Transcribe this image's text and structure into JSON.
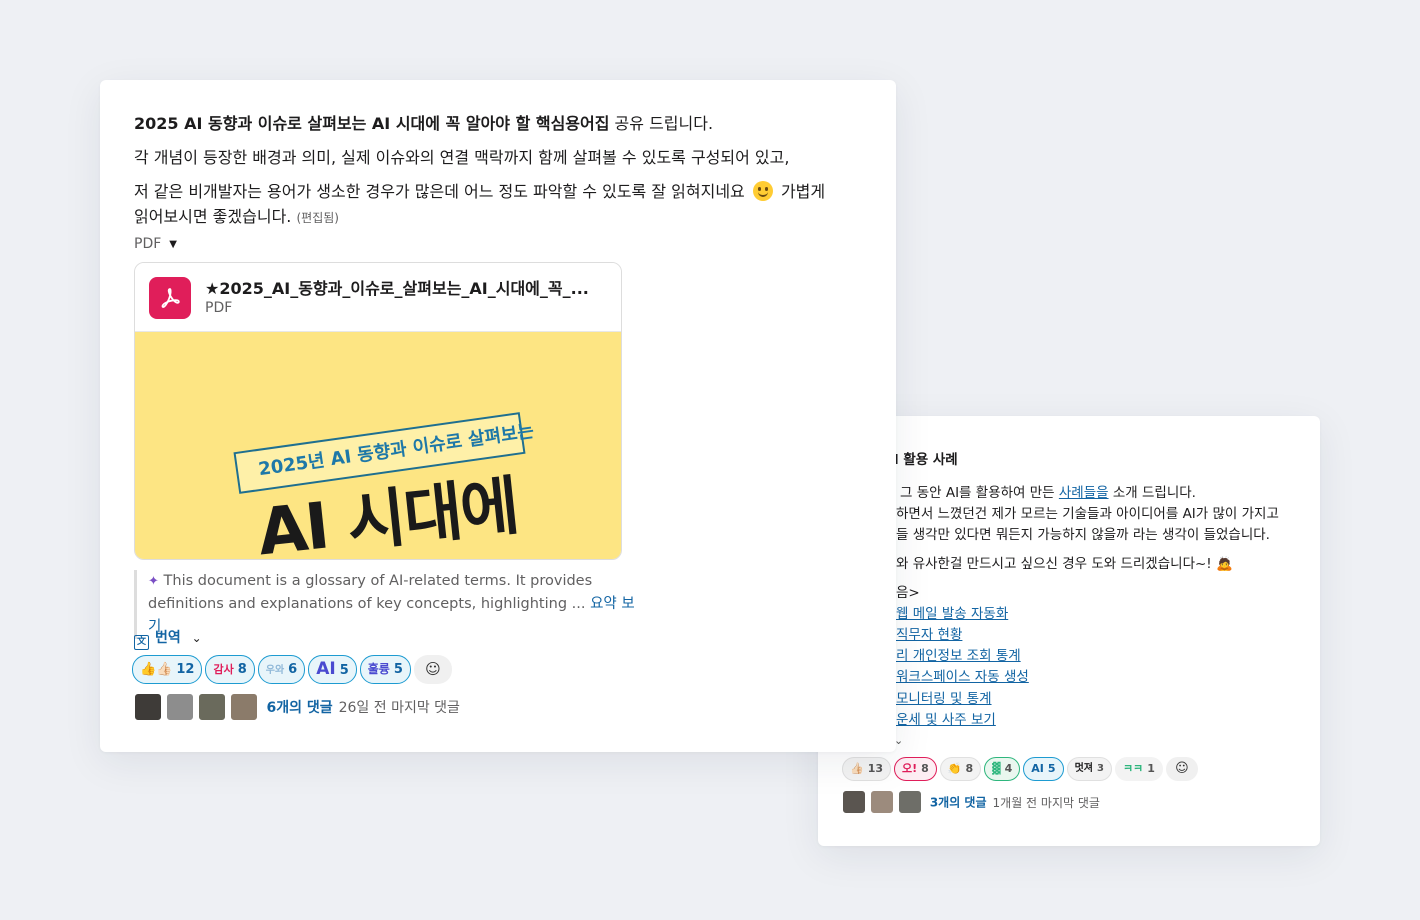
{
  "back_card": {
    "title": "l 활용 사례",
    "line1_pre": "그 동안 AI를 활용하여 만든 ",
    "line1_link": "사례들을",
    "line1_post": " 소개 드립니다.",
    "line2": "하면서 느꼈던건 제가 모르는 기술들과 아이디어를 AI가 많이 가지고",
    "line3": "들 생각만 있다면 뭐든지 가능하지 않을까 라는 생각이 들었습니다.",
    "line4": "와 유사한걸 만드시고 싶으신 경우 도와 드리겠습니다~! 🙇",
    "list_header": "음>",
    "list": [
      "웹 메일 발송 자동화",
      "직무자 현황",
      "리 개인정보 조회 통계",
      "워크스페이스 자동 생성",
      "모니터링 및 통계",
      "운세 및 사주 보기"
    ],
    "reactions": [
      {
        "emoji": "👍🏻",
        "count": "13",
        "style": "plain"
      },
      {
        "emoji": "오!",
        "count": "8",
        "style": "pink"
      },
      {
        "emoji": "👏",
        "count": "8",
        "style": "plain"
      },
      {
        "emoji": "▓",
        "count": "4",
        "style": "green"
      },
      {
        "emoji": "AI",
        "count": "5",
        "style": "blue"
      },
      {
        "emoji": "멋져",
        "count": "3",
        "style": "blue"
      },
      {
        "emoji": "ㅋㅋ",
        "count": "1",
        "style": "plain"
      }
    ],
    "reply_count": "3개의 댓글",
    "reply_time": "1개월 전 마지막 댓글"
  },
  "front_card": {
    "line1_bold": "2025 AI 동향과 이슈로 살펴보는 AI 시대에 꼭 알아야 할 핵심용어집",
    "line1_rest": " 공유 드립니다.",
    "line2": "각 개념이 등장한 배경과 의미, 실제 이슈와의 연결 맥락까지 함께 살펴볼 수 있도록 구성되어 있고,",
    "line3_pre": "저 같은 비개발자는 용어가 생소한 경우가 많은데 어느 정도 파악할 수 있도록 잘 읽혀지네요",
    "line3_post": " 가볍게",
    "line4": "읽어보시면 좋겠습니다.",
    "edited": "(편집됨)",
    "pdf_label": "PDF",
    "file": {
      "name": "★2025_AI_동향과_이슈로_살펴보는_AI_시대에_꼭_...",
      "type": "PDF",
      "preview_ribbon": "2025년 AI 동향과 이슈로 살펴보는",
      "preview_title": "AI 시대에"
    },
    "summary_text": "This document is a glossary of AI-related terms. It provides",
    "summary_text2": "definitions and explanations of key concepts, highlighting ... ",
    "summary_link": "요약 보기",
    "translate": "번역",
    "reactions": [
      {
        "emoji": "👍👍🏻",
        "count": "12",
        "style": "blue"
      },
      {
        "emoji": "감사",
        "count": "8",
        "style": "pink"
      },
      {
        "emoji": "우와",
        "count": "6",
        "style": "blue"
      },
      {
        "emoji": "AI",
        "count": "5",
        "style": "blue"
      },
      {
        "emoji": "훌륭",
        "count": "5",
        "style": "blue"
      }
    ],
    "reply_count": "6개의 댓글",
    "reply_time": "26일 전 마지막 댓글"
  }
}
